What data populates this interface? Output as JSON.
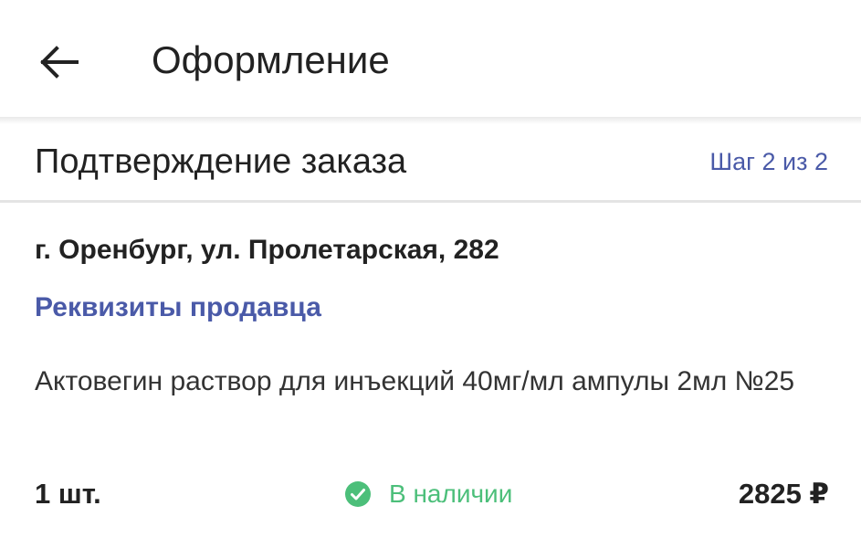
{
  "appbar": {
    "title": "Оформление",
    "back_icon": "arrow-left-icon"
  },
  "step": {
    "title": "Подтверждение заказа",
    "counter": "Шаг 2 из 2"
  },
  "order": {
    "address": "г. Оренбург, ул. Пролетарская, 282",
    "seller_link": "Реквизиты продавца",
    "product_name": "Актовегин раствор для инъекций 40мг/мл ампулы 2мл №25",
    "quantity": "1 шт.",
    "stock_status": "В наличии",
    "stock_icon": "check-circle-icon",
    "price": "2825 ₽"
  },
  "colors": {
    "accent": "#4a5aa8",
    "in_stock": "#4cbf7a",
    "text": "#222222"
  }
}
